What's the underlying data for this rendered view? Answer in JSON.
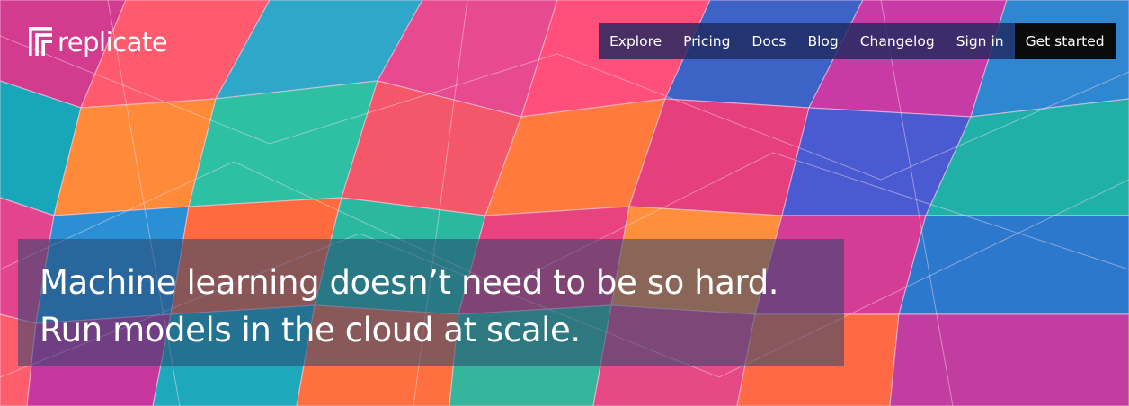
{
  "brand": {
    "name": "replicate"
  },
  "nav": {
    "links": [
      "Explore",
      "Pricing",
      "Docs",
      "Blog",
      "Changelog",
      "Sign in"
    ],
    "cta": "Get started"
  },
  "hero": {
    "line1": "Machine learning doesn’t need to be so hard.",
    "line2": "Run models in the cloud at scale."
  },
  "colors": {
    "nav_background": "#1e285f",
    "cta_background": "#0b0b0b",
    "text": "#ffffff"
  },
  "icons": {
    "logo": "replicate-logo-icon"
  }
}
